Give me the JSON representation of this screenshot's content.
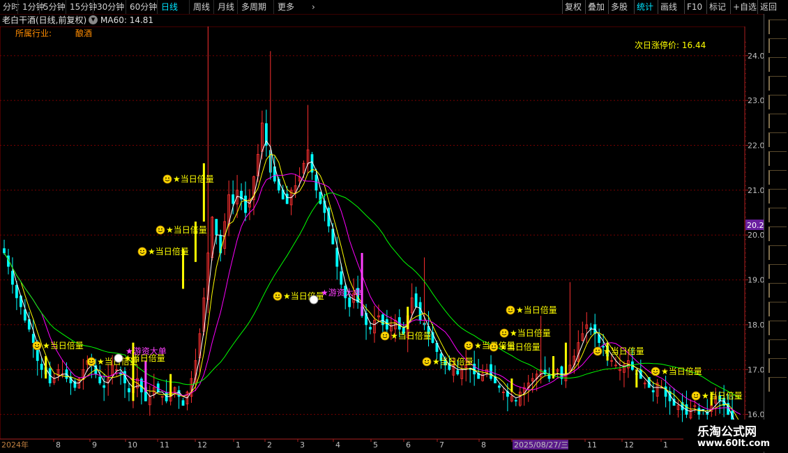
{
  "toolbar": {
    "left_items": [
      "分时",
      "1分钟",
      "5分钟",
      "15分钟",
      "30分钟",
      "60分钟",
      "日线",
      "周线",
      "月线",
      "多周期",
      "更多"
    ],
    "active_index": 6,
    "more_chevron": "chevron-right-icon",
    "right_items": [
      "复权",
      "叠加",
      "多股",
      "统计",
      "画线",
      "F10",
      "标记",
      "+自选",
      "返回"
    ],
    "right_selected_index": 3
  },
  "title": {
    "stock": "老白干酒(日线,前复权)",
    "dropdown_icon": "chevron-down-circle-icon",
    "ma_label": "MA60: 14.81",
    "industry_label": "所属行业:",
    "industry_value": "酿酒",
    "next_limit_label": "次日涨停价: 16.44"
  },
  "axis": {
    "y_ticks": [
      "24.00",
      "23.00",
      "22.00",
      "21.00",
      "20.00",
      "19.00",
      "18.00",
      "17.00",
      "16.00"
    ],
    "current_price": "20.22",
    "x_labels": [
      "2024年",
      "8",
      "9",
      "10",
      "11",
      "12",
      "1",
      "2",
      "3",
      "4",
      "5",
      "6",
      "7",
      "8",
      "2025/08/27/三",
      "11",
      "12",
      "1"
    ]
  },
  "signals": {
    "label_a": "★当日倍量",
    "label_b": "★游资大单"
  },
  "right_vertical_text": [
    "…"
  ],
  "watermark": {
    "line1": "乐淘公式网",
    "line2": "www.60lt.com"
  },
  "colors": {
    "up": "#ff3030",
    "down": "#00ffff",
    "ma_short": "#ffffff",
    "ma_yellow": "#ffff00",
    "ma_magenta": "#ff00ff",
    "ma60": "#00ff00",
    "signal_text": "#ffff00",
    "signal_b": "#ff40ff",
    "grid": "#8b0000",
    "axis_text": "#c0c0c0"
  },
  "chart_data": {
    "type": "candlestick",
    "ylim": [
      15.45,
      24.65
    ],
    "close": [
      19.6,
      19.3,
      18.9,
      18.6,
      18.4,
      18.1,
      17.9,
      17.6,
      17.2,
      17.0,
      16.9,
      16.7,
      16.8,
      17.0,
      16.9,
      16.8,
      16.7,
      16.6,
      16.8,
      17.0,
      17.2,
      17.1,
      16.9,
      16.7,
      16.6,
      16.8,
      17.1,
      17.0,
      16.9,
      16.7,
      16.5,
      16.6,
      16.8,
      16.5,
      16.3,
      16.4,
      16.6,
      16.5,
      16.4,
      16.3,
      16.5,
      16.6,
      16.4,
      16.2,
      16.5,
      16.8,
      17.2,
      17.8,
      18.6,
      19.6,
      20.4,
      20.0,
      19.6,
      20.3,
      20.9,
      20.7,
      21.0,
      20.8,
      20.5,
      20.8,
      21.3,
      21.8,
      22.5,
      22.0,
      21.4,
      21.2,
      21.0,
      20.8,
      20.7,
      21.0,
      21.1,
      21.3,
      21.6,
      21.9,
      21.4,
      21.0,
      20.7,
      20.5,
      20.2,
      19.8,
      19.3,
      18.9,
      18.6,
      18.4,
      18.7,
      18.5,
      18.2,
      18.0,
      17.9,
      18.1,
      18.2,
      18.0,
      17.9,
      18.0,
      18.1,
      17.9,
      17.8,
      18.2,
      18.6,
      18.4,
      18.1,
      18.0,
      17.8,
      17.6,
      17.4,
      17.2,
      17.1,
      17.0,
      17.1,
      16.9,
      17.0,
      17.1,
      17.0,
      16.9,
      16.8,
      16.9,
      17.0,
      16.8,
      16.7,
      16.6,
      16.5,
      16.4,
      16.4,
      16.3,
      16.5,
      16.6,
      16.7,
      16.8,
      16.9,
      17.0,
      16.9,
      16.8,
      16.9,
      17.0,
      16.8,
      16.9,
      17.1,
      17.3,
      17.6,
      17.8,
      18.0,
      17.9,
      17.8,
      17.6,
      17.5,
      17.3,
      17.2,
      17.1,
      17.0,
      17.1,
      17.2,
      17.0,
      16.9,
      16.8,
      16.7,
      16.6,
      16.5,
      16.7,
      16.6,
      16.4,
      16.3,
      16.2,
      16.2,
      16.1,
      16.0,
      16.1,
      16.2,
      16.0,
      16.1,
      16.0,
      16.2,
      16.4,
      16.3,
      16.2,
      16.0,
      15.7,
      15.6,
      15.5
    ]
  }
}
